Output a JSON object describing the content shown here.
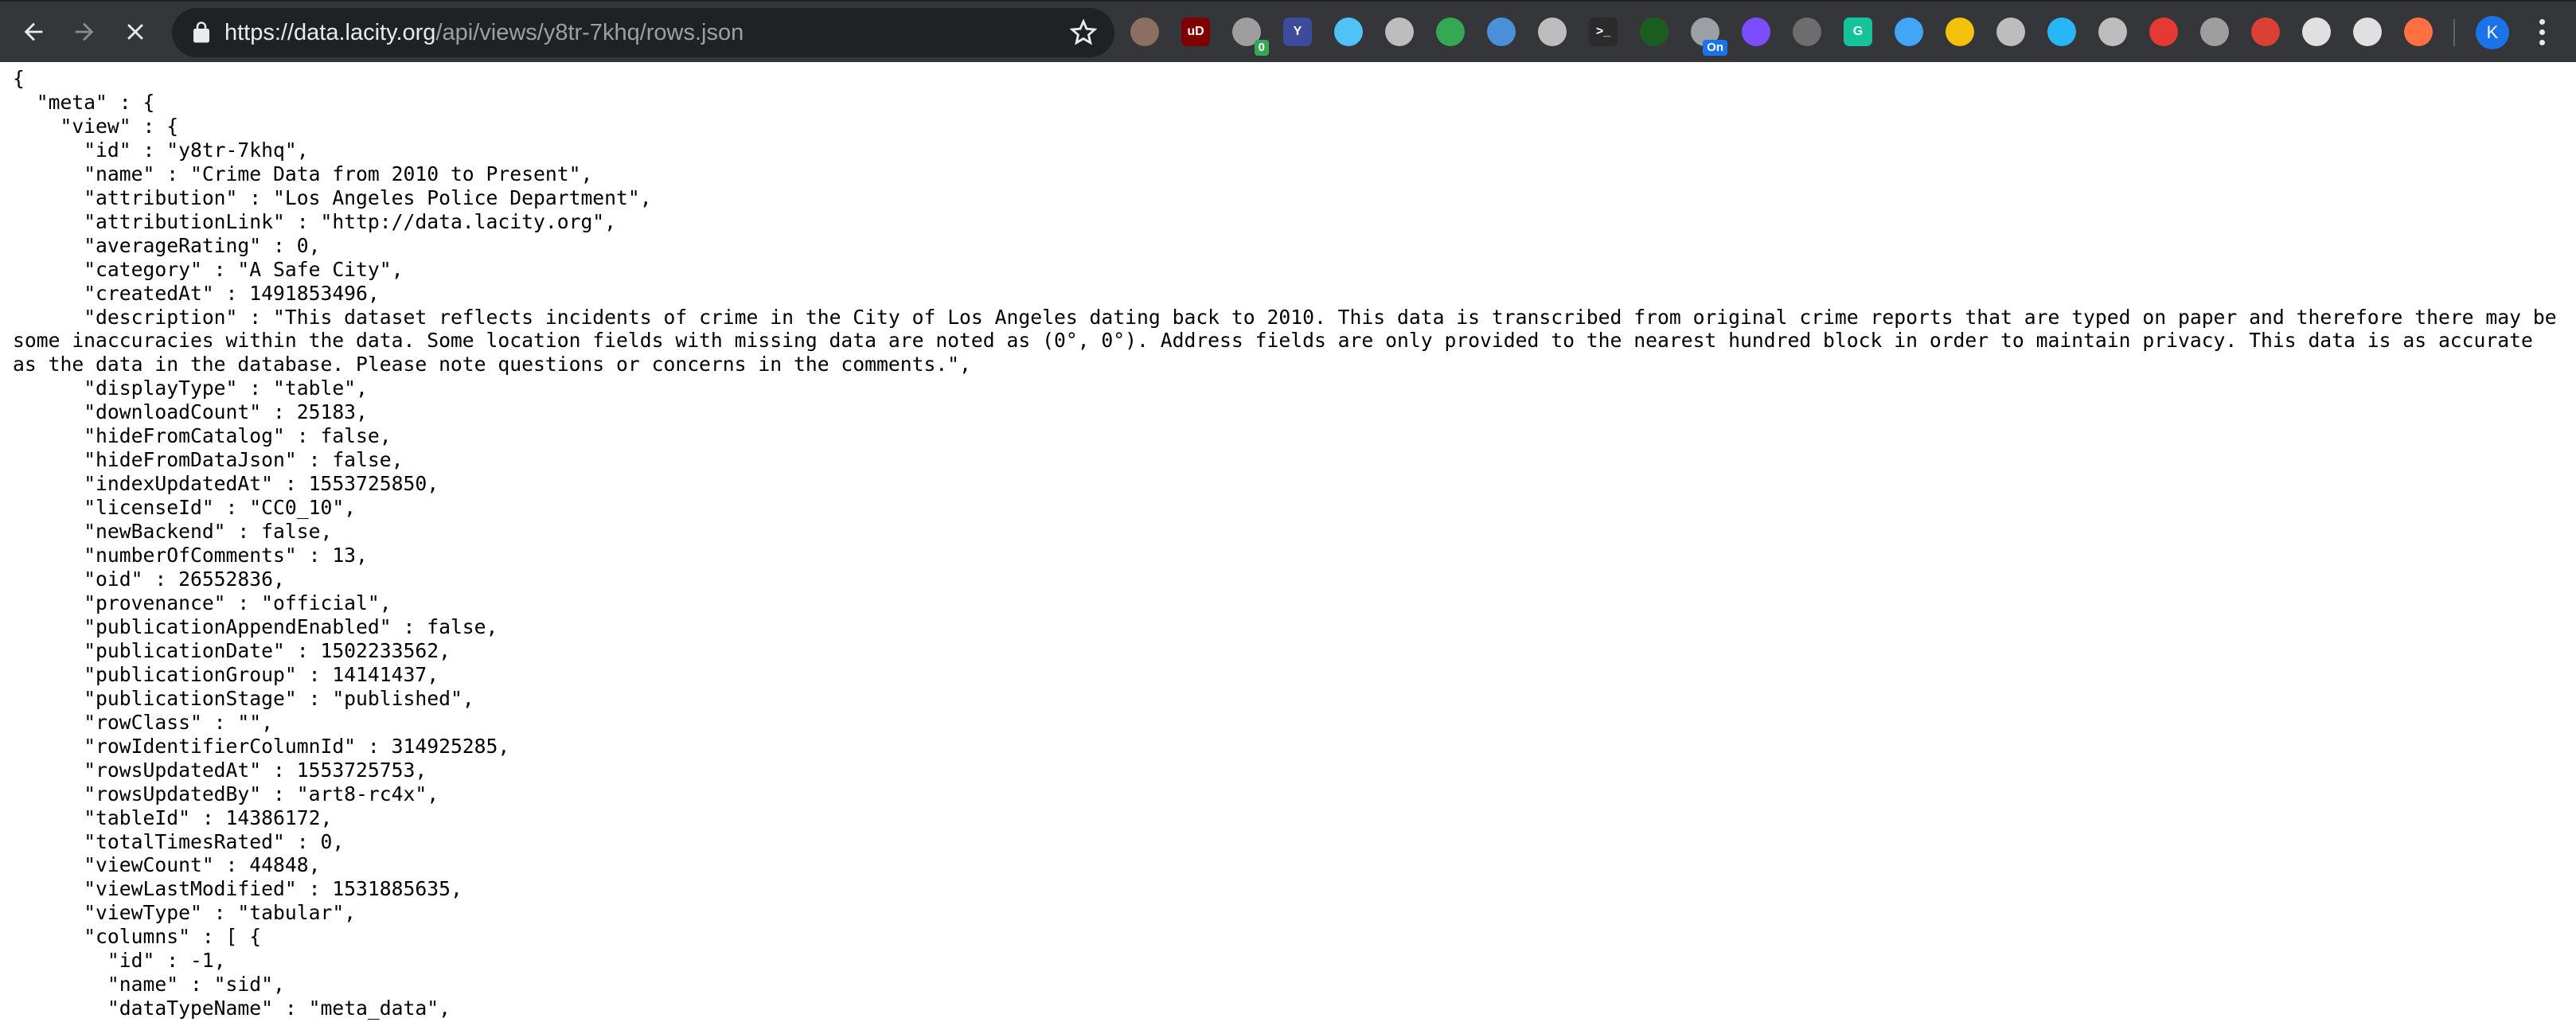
{
  "browser": {
    "url_host": "https://data.lacity.org",
    "url_path": "/api/views/y8tr-7khq/rows.json",
    "extensions": [
      {
        "icon": "spy-extension-icon",
        "color": "#8d6e63"
      },
      {
        "icon": "ublock-icon",
        "color": "#800000",
        "text": "uD"
      },
      {
        "icon": "cookie-extension-icon",
        "color": "#9e9e9e",
        "badge": "0",
        "badge_color": "#34a853"
      },
      {
        "icon": "yoast-extension-icon",
        "color": "#3c4b9a",
        "text": "Y"
      },
      {
        "icon": "globe-extension-icon",
        "color": "#4fc3f7"
      },
      {
        "icon": "disc-extension-icon",
        "color": "#bdbdbd"
      },
      {
        "icon": "map-pin-extension-icon",
        "color": "#34a853"
      },
      {
        "icon": "screenshot-extension-icon",
        "color": "#4a90d9"
      },
      {
        "icon": "download-extension-icon",
        "color": "#bdbdbd"
      },
      {
        "icon": "terminal-extension-icon",
        "color": "#2b2b2b",
        "text": ">_"
      },
      {
        "icon": "color-picker-extension-icon",
        "color": "#1b5e20"
      },
      {
        "icon": "tab-extension-icon",
        "color": "#9aa0a6",
        "badge": "On",
        "badge_color": "#1a73e8"
      },
      {
        "icon": "circle-purple-extension-icon",
        "color": "#7c4dff"
      },
      {
        "icon": "react-extension-icon",
        "color": "#6d6d6d"
      },
      {
        "icon": "grammarly-icon",
        "color": "#15c39a",
        "text": "G"
      },
      {
        "icon": "wifi-signal-extension-icon",
        "color": "#42a5f5"
      },
      {
        "icon": "notes-extension-icon",
        "color": "#f4c20d"
      },
      {
        "icon": "drive-icon",
        "color": "#bdbdbd"
      },
      {
        "icon": "refresh-circle-extension-icon",
        "color": "#29b6f6"
      },
      {
        "icon": "tag-extension-icon",
        "color": "#bdbdbd"
      },
      {
        "icon": "heart-check-extension-icon",
        "color": "#e53935"
      },
      {
        "icon": "graduation-cap-extension-icon",
        "color": "#9e9e9e"
      },
      {
        "icon": "todoist-icon",
        "color": "#db4035"
      },
      {
        "icon": "share-arrow-extension-icon",
        "color": "#e0e0e0"
      },
      {
        "icon": "sound-extension-icon",
        "color": "#e0e0e0"
      },
      {
        "icon": "gauge-extension-icon",
        "color": "#ff7043"
      }
    ],
    "avatar_initial": "K"
  },
  "json_text": "{\n  \"meta\" : {\n    \"view\" : {\n      \"id\" : \"y8tr-7khq\",\n      \"name\" : \"Crime Data from 2010 to Present\",\n      \"attribution\" : \"Los Angeles Police Department\",\n      \"attributionLink\" : \"http://data.lacity.org\",\n      \"averageRating\" : 0,\n      \"category\" : \"A Safe City\",\n      \"createdAt\" : 1491853496,\n      \"description\" : \"This dataset reflects incidents of crime in the City of Los Angeles dating back to 2010. This data is transcribed from original crime reports that are typed on paper and therefore there may be some inaccuracies within the data. Some location fields with missing data are noted as (0°, 0°). Address fields are only provided to the nearest hundred block in order to maintain privacy. This data is as accurate as the data in the database. Please note questions or concerns in the comments.\",\n      \"displayType\" : \"table\",\n      \"downloadCount\" : 25183,\n      \"hideFromCatalog\" : false,\n      \"hideFromDataJson\" : false,\n      \"indexUpdatedAt\" : 1553725850,\n      \"licenseId\" : \"CC0_10\",\n      \"newBackend\" : false,\n      \"numberOfComments\" : 13,\n      \"oid\" : 26552836,\n      \"provenance\" : \"official\",\n      \"publicationAppendEnabled\" : false,\n      \"publicationDate\" : 1502233562,\n      \"publicationGroup\" : 14141437,\n      \"publicationStage\" : \"published\",\n      \"rowClass\" : \"\",\n      \"rowIdentifierColumnId\" : 314925285,\n      \"rowsUpdatedAt\" : 1553725753,\n      \"rowsUpdatedBy\" : \"art8-rc4x\",\n      \"tableId\" : 14386172,\n      \"totalTimesRated\" : 0,\n      \"viewCount\" : 44848,\n      \"viewLastModified\" : 1531885635,\n      \"viewType\" : \"tabular\",\n      \"columns\" : [ {\n        \"id\" : -1,\n        \"name\" : \"sid\",\n        \"dataTypeName\" : \"meta_data\","
}
